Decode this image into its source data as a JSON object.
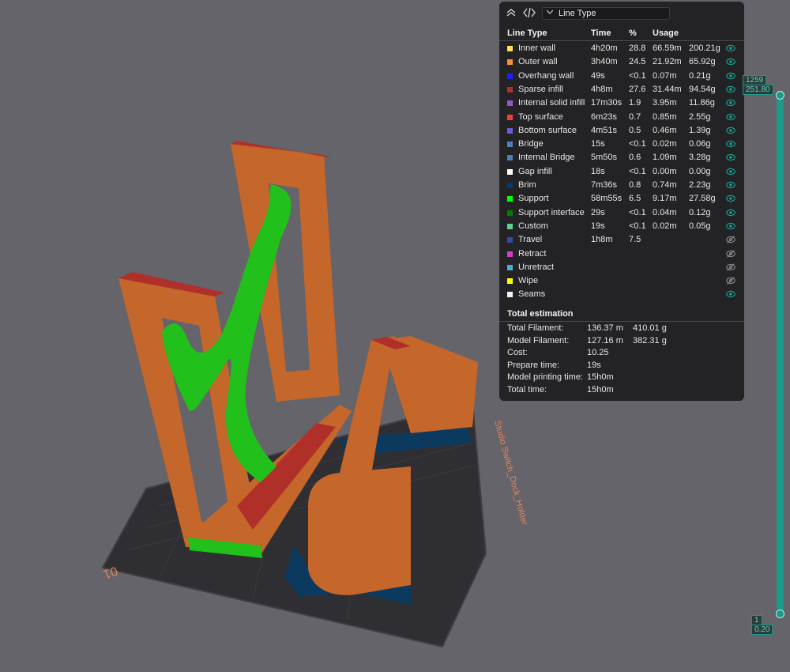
{
  "toolbar": {
    "collapse_icon": "double-chevron-up-icon",
    "code_icon": "code-brackets-icon",
    "view_select": {
      "chevron_icon": "chevron-down-icon",
      "value": "Line Type"
    }
  },
  "legend": {
    "headers": {
      "type": "Line Type",
      "time": "Time",
      "pct": "%",
      "usage": "Usage"
    },
    "rows": [
      {
        "name": "Inner wall",
        "color": "#ffe14d",
        "time": "4h20m",
        "pct": "28.8",
        "len": "66.59m",
        "weight": "200.21g",
        "visible": true
      },
      {
        "name": "Outer wall",
        "color": "#ff8c38",
        "time": "3h40m",
        "pct": "24.5",
        "len": "21.92m",
        "weight": "65.92g",
        "visible": true
      },
      {
        "name": "Overhang wall",
        "color": "#1f1fff",
        "time": "49s",
        "pct": "<0.1",
        "len": "0.07m",
        "weight": "0.21g",
        "visible": true
      },
      {
        "name": "Sparse infill",
        "color": "#b03029",
        "time": "4h8m",
        "pct": "27.6",
        "len": "31.44m",
        "weight": "94.54g",
        "visible": true
      },
      {
        "name": "Internal solid infill",
        "color": "#9654cc",
        "time": "17m30s",
        "pct": "1.9",
        "len": "3.95m",
        "weight": "11.86g",
        "visible": true
      },
      {
        "name": "Top surface",
        "color": "#f04040",
        "time": "6m23s",
        "pct": "0.7",
        "len": "0.85m",
        "weight": "2.55g",
        "visible": true
      },
      {
        "name": "Bottom surface",
        "color": "#6a5fdc",
        "time": "4m51s",
        "pct": "0.5",
        "len": "0.46m",
        "weight": "1.39g",
        "visible": true
      },
      {
        "name": "Bridge",
        "color": "#4d80ba",
        "time": "15s",
        "pct": "<0.1",
        "len": "0.02m",
        "weight": "0.06g",
        "visible": true
      },
      {
        "name": "Internal Bridge",
        "color": "#4d80ba",
        "time": "5m50s",
        "pct": "0.6",
        "len": "1.09m",
        "weight": "3.28g",
        "visible": true
      },
      {
        "name": "Gap infill",
        "color": "#ffffff",
        "time": "18s",
        "pct": "<0.1",
        "len": "0.00m",
        "weight": "0.00g",
        "visible": true
      },
      {
        "name": "Brim",
        "color": "#003b6e",
        "time": "7m36s",
        "pct": "0.8",
        "len": "0.74m",
        "weight": "2.23g",
        "visible": true
      },
      {
        "name": "Support",
        "color": "#00ff00",
        "time": "58m55s",
        "pct": "6.5",
        "len": "9.17m",
        "weight": "27.58g",
        "visible": true
      },
      {
        "name": "Support interface",
        "color": "#008000",
        "time": "29s",
        "pct": "<0.1",
        "len": "0.04m",
        "weight": "0.12g",
        "visible": true
      },
      {
        "name": "Custom",
        "color": "#5ed194",
        "time": "19s",
        "pct": "<0.1",
        "len": "0.02m",
        "weight": "0.05g",
        "visible": true
      },
      {
        "name": "Travel",
        "color": "#384aa6",
        "time": "1h8m",
        "pct": "7.5",
        "len": "",
        "weight": "",
        "visible": false
      },
      {
        "name": "Retract",
        "color": "#cc3dcc",
        "time": "",
        "pct": "",
        "len": "",
        "weight": "",
        "visible": false
      },
      {
        "name": "Unretract",
        "color": "#4dadd9",
        "time": "",
        "pct": "",
        "len": "",
        "weight": "",
        "visible": false
      },
      {
        "name": "Wipe",
        "color": "#ffff00",
        "time": "",
        "pct": "",
        "len": "",
        "weight": "",
        "visible": false
      },
      {
        "name": "Seams",
        "color": "#f2f2f2",
        "time": "",
        "pct": "",
        "len": "",
        "weight": "",
        "visible": true
      }
    ]
  },
  "totals": {
    "title": "Total estimation",
    "rows": [
      {
        "label": "Total Filament:",
        "v1": "136.37 m",
        "v2": "410.01 g"
      },
      {
        "label": "Model Filament:",
        "v1": "127.16 m",
        "v2": "382.31 g"
      },
      {
        "label": "Cost:",
        "v1": "10.25",
        "v2": ""
      },
      {
        "label": "Prepare time:",
        "v1": "19s",
        "v2": ""
      },
      {
        "label": "Model printing time:",
        "v1": "15h0m",
        "v2": ""
      },
      {
        "label": "Total time:",
        "v1": "15h0m",
        "v2": ""
      }
    ]
  },
  "slider": {
    "top_layer": "1259",
    "top_height": "251.80",
    "bottom_layer": "1",
    "bottom_height": "0.20"
  },
  "scene": {
    "plate_name": "Studio Switch_Dock_Holder",
    "plate_label": "01",
    "colors": {
      "outer_wall": "#c5662a",
      "sparse_infill": "#b03029",
      "support": "#22c01a",
      "brim": "#0c3a5e",
      "plate": "#2f2f33"
    }
  }
}
